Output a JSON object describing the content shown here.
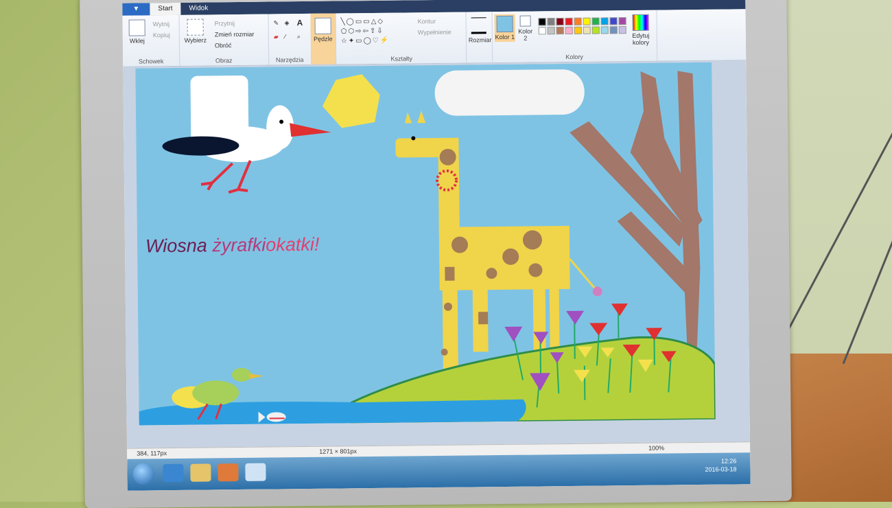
{
  "tabs": {
    "app_menu": "▼",
    "home": "Start",
    "view": "Widok"
  },
  "clipboard": {
    "paste": "Wklej",
    "cut": "Wytnij",
    "copy": "Kopiuj",
    "label": "Schowek"
  },
  "image": {
    "select": "Wybierz",
    "crop": "Przytnij",
    "resize": "Zmień rozmiar",
    "rotate": "Obróć",
    "label": "Obraz"
  },
  "tools": {
    "label": "Narzędzia"
  },
  "brushes": {
    "label": "Pędzle"
  },
  "shapes": {
    "outline": "Kontur",
    "fill": "Wypełnienie",
    "label": "Kształty"
  },
  "size": {
    "label": "Rozmiar"
  },
  "colors": {
    "color1": "Kolor 1",
    "color2": "Kolor 2",
    "edit": "Edytuj kolory",
    "label": "Kolory",
    "palette": [
      "#000000",
      "#7f7f7f",
      "#880015",
      "#ed1c24",
      "#ff7f27",
      "#fff200",
      "#22b14c",
      "#00a2e8",
      "#3f48cc",
      "#a349a4",
      "#ffffff",
      "#c3c3c3",
      "#b97a57",
      "#ffaec9",
      "#ffc90e",
      "#efe4b0",
      "#b5e61d",
      "#99d9ea",
      "#7092be",
      "#c8bfe7"
    ]
  },
  "drawing": {
    "text_word1": "Wiosna",
    "text_word2": "żyrafki",
    "text_word3": "okatki!",
    "sky": "#7fc3e4"
  },
  "status": {
    "cursor_pos": "384, 117px",
    "canvas_size": "1271 × 801px",
    "zoom": "100%"
  },
  "taskbar": {
    "time": "12:26",
    "date": "2016-03-18"
  }
}
